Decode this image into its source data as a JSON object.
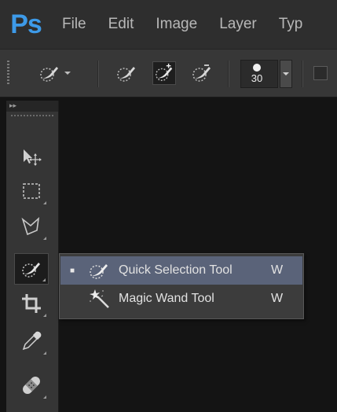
{
  "app": {
    "logo": "Ps"
  },
  "menu": [
    "File",
    "Edit",
    "Image",
    "Layer",
    "Typ"
  ],
  "options": {
    "brush_size": "30",
    "tool_modes": [
      "quick-selection-tool",
      "new-selection",
      "add-to-selection",
      "subtract-from-selection"
    ]
  },
  "toolbox": {
    "collapse_glyph": "▸▸",
    "tools": [
      {
        "name": "move-tool",
        "icon": "move-icon"
      },
      {
        "name": "rectangular-marquee-tool",
        "icon": "marquee-icon"
      },
      {
        "name": "lasso-tool",
        "icon": "polygonal-lasso-icon"
      },
      {
        "name": "quick-selection-tool",
        "icon": "quick-selection-icon",
        "active": true
      },
      {
        "name": "crop-tool",
        "icon": "crop-icon"
      },
      {
        "name": "eyedropper-tool",
        "icon": "eyedropper-icon"
      },
      {
        "name": "healing-brush-tool",
        "icon": "bandage-icon"
      }
    ]
  },
  "flyout": {
    "items": [
      {
        "bullet": "■",
        "label": "Quick Selection Tool",
        "shortcut": "W",
        "selected": true,
        "icon": "quick-selection-icon"
      },
      {
        "bullet": "",
        "label": "Magic Wand Tool",
        "shortcut": "W",
        "selected": false,
        "icon": "magic-wand-icon"
      }
    ]
  },
  "colors": {
    "logo_blue": "#3d9ae8",
    "menu_bg": "#2e2e2e",
    "options_bg": "#373737",
    "toolbox_bg": "#353535",
    "canvas_bg": "#141414",
    "flyout_selected": "#5a6379"
  }
}
